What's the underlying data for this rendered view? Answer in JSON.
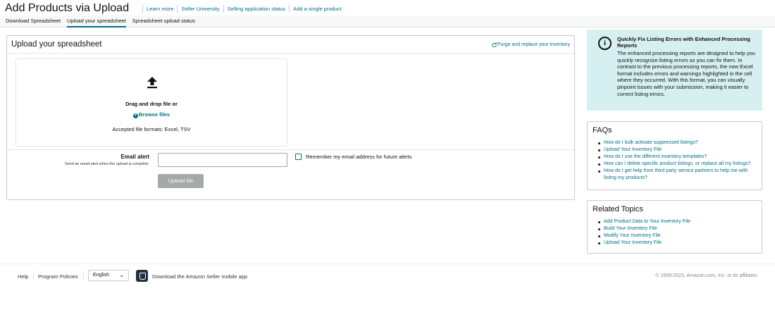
{
  "header": {
    "title": "Add Products via Upload",
    "links": [
      "Learn more",
      "Seller University",
      "Selling application status",
      "Add a single product"
    ]
  },
  "tabs": [
    {
      "label": "Download Spreadsheet",
      "active": false
    },
    {
      "label": "Upload your spreadsheet",
      "active": true
    },
    {
      "label": "Spreadsheet upload status",
      "active": false
    }
  ],
  "upload_panel": {
    "title": "Upload your spreadsheet",
    "purge_link": "Purge and replace your inventory",
    "drag_text": "Drag and drop file or",
    "browse_label": "Browse files",
    "formats_text": "Accepted file formats: Excel, TSV",
    "email_label": "Email alert",
    "email_sub": "Send an email alert when the upload is complete.",
    "email_value": "",
    "remember_label": "Remember my email address for future alerts",
    "remember_checked": false,
    "upload_button": "Upload file"
  },
  "info_box": {
    "title": "Quickly Fix Listing Errors with Enhanced Processing Reports",
    "body": "The enhanced processing reports are designed to help you quickly recognize listing errors so you can fix them. In contrast to the previous processing reports, the new Excel format includes errors and warnings highlighted in the cell where they occurred. With this format, you can visually pinpoint issues with your submission, making it easier to correct listing errors."
  },
  "faqs": {
    "title": "FAQs",
    "items": [
      "How do I bulk activate suppressed listings?",
      "Upload Your Inventory File",
      "How do I use the different inventory templates?",
      "How can I delete specific product listings, or replace all my listings?",
      "How do I get help from third party service partners to help me with listing my products?"
    ]
  },
  "related": {
    "title": "Related Topics",
    "items": [
      "Add Product Data to Your Inventory File",
      "Build Your Inventory File",
      "Modify Your Inventory File",
      "Upload Your Inventory File"
    ]
  },
  "footer": {
    "help": "Help",
    "program_policies": "Program Policies",
    "language": "English",
    "app_text": "Download the Amazon Seller mobile app",
    "copyright": "© 1999-2023, Amazon.com, Inc. or its affiliates"
  },
  "colors": {
    "link": "#007185",
    "info_bg": "#d6eff1",
    "button_disabled": "#a4a9a9"
  }
}
